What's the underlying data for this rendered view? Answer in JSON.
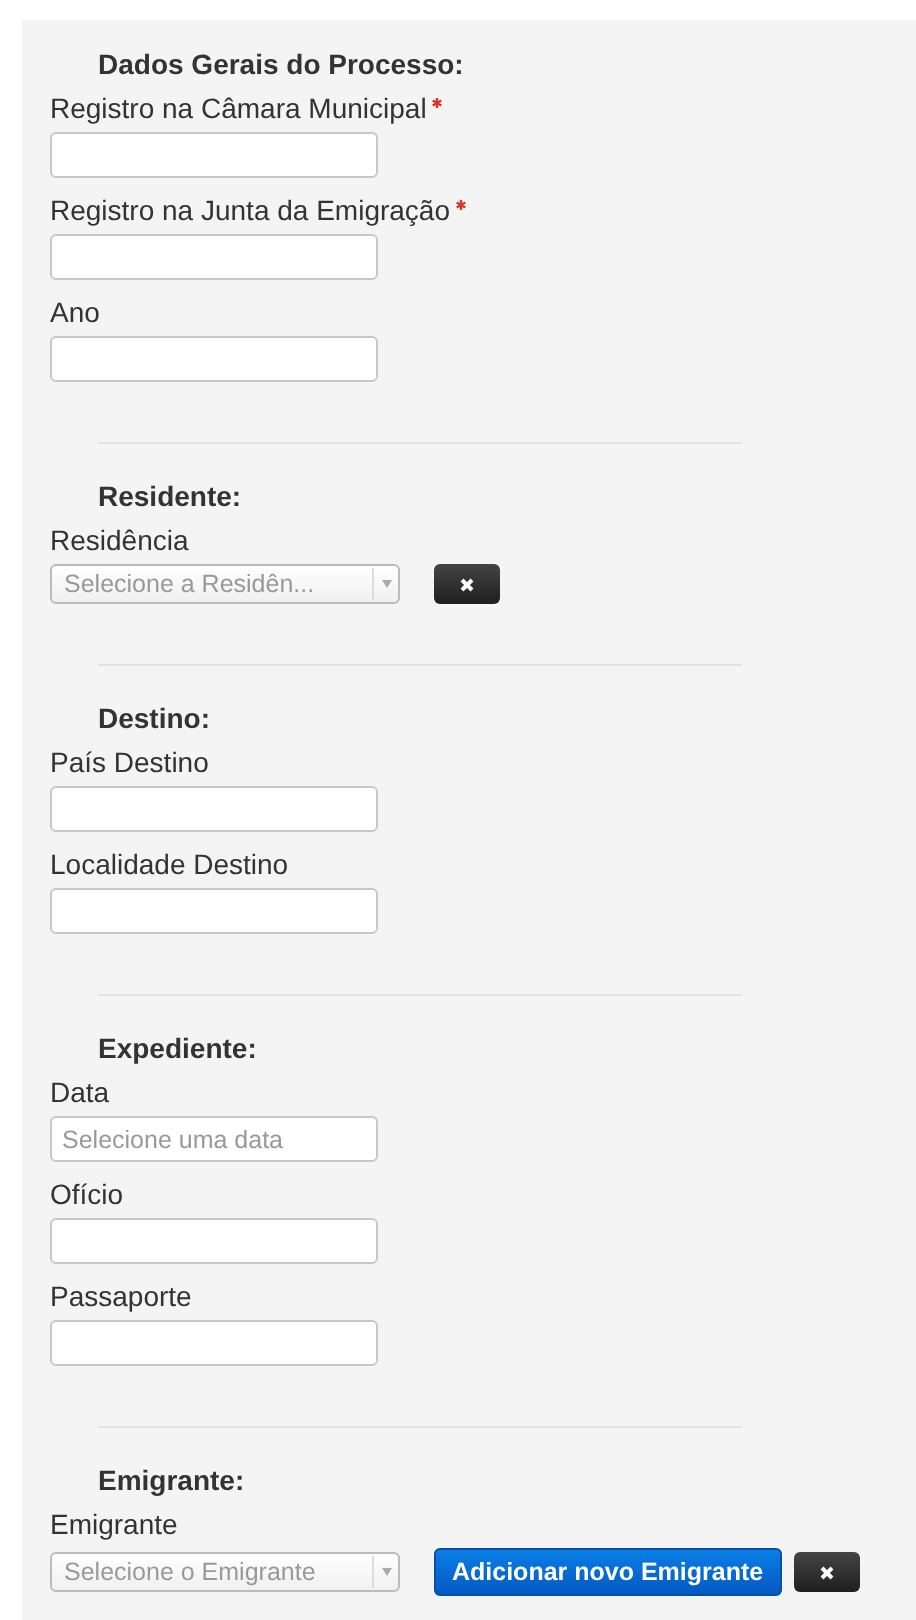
{
  "sections": [
    {
      "title": "Dados Gerais do Processo:",
      "fields": [
        {
          "kind": "text",
          "label": "Registro na Câmara Municipal",
          "required": true
        },
        {
          "kind": "text",
          "label": "Registro na Junta da Emigração",
          "required": true
        },
        {
          "kind": "text",
          "label": "Ano",
          "required": false
        }
      ]
    },
    {
      "title": "Residente:",
      "fields": [
        {
          "kind": "select",
          "label": "Residência",
          "required": false,
          "placeholder": "Selecione a Residên...",
          "buttons": [
            {
              "kind": "clear"
            }
          ]
        }
      ]
    },
    {
      "title": "Destino:",
      "fields": [
        {
          "kind": "text",
          "label": "País Destino",
          "required": false
        },
        {
          "kind": "text",
          "label": "Localidade Destino",
          "required": false
        }
      ]
    },
    {
      "title": "Expediente:",
      "fields": [
        {
          "kind": "text",
          "label": "Data",
          "required": false,
          "placeholder": "Selecione uma data"
        },
        {
          "kind": "text",
          "label": "Ofício",
          "required": false
        },
        {
          "kind": "text",
          "label": "Passaporte",
          "required": false
        }
      ]
    },
    {
      "title": "Emigrante:",
      "fields": [
        {
          "kind": "select",
          "label": "Emigrante",
          "required": false,
          "placeholder": "Selecione o Emigrante",
          "buttons": [
            {
              "kind": "add",
              "label": "Adicionar novo Emigrante"
            },
            {
              "kind": "clear"
            }
          ]
        }
      ]
    }
  ]
}
